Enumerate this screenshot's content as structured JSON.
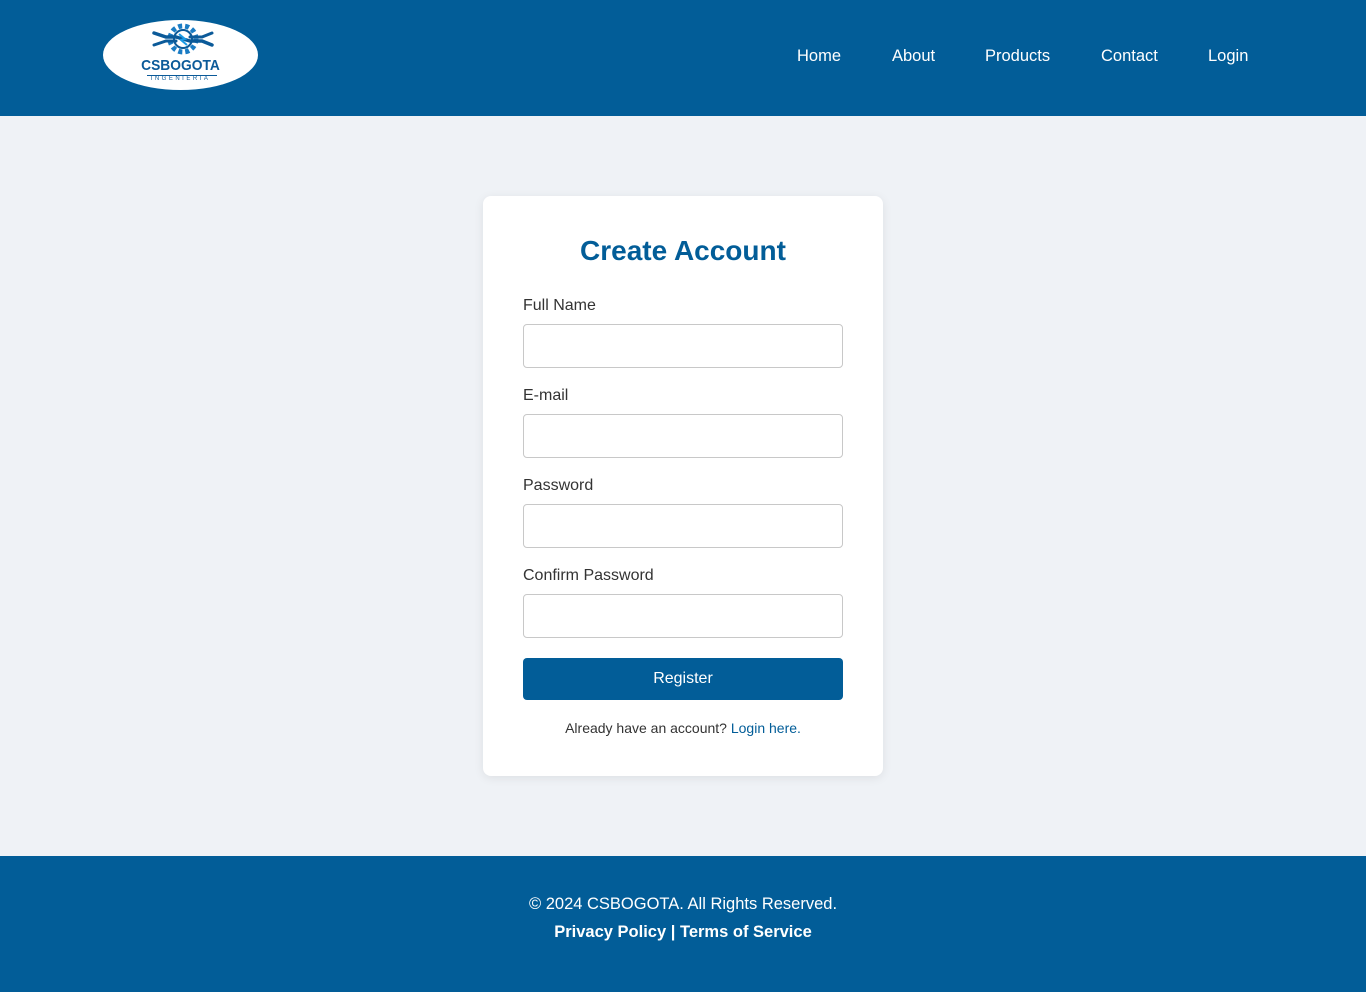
{
  "header": {
    "logo": {
      "brand": "CSBOGOTA",
      "sub": "INGENIERIA"
    },
    "nav": [
      {
        "label": "Home"
      },
      {
        "label": "About"
      },
      {
        "label": "Products"
      },
      {
        "label": "Contact"
      },
      {
        "label": "Login"
      }
    ]
  },
  "form": {
    "title": "Create Account",
    "fields": [
      {
        "label": "Full Name",
        "value": "",
        "placeholder": ""
      },
      {
        "label": "E-mail",
        "value": "",
        "placeholder": ""
      },
      {
        "label": "Password",
        "value": "",
        "placeholder": ""
      },
      {
        "label": "Confirm Password",
        "value": "",
        "placeholder": ""
      }
    ],
    "submit_label": "Register",
    "login_prompt": "Already have an account?",
    "login_link": "Login here."
  },
  "footer": {
    "copyright": "© 2024 CSBOGOTA. All Rights Reserved.",
    "privacy": "Privacy Policy",
    "separator": "|",
    "terms": "Terms of Service"
  },
  "colors": {
    "brand": "#025d98",
    "background": "#eff2f6"
  }
}
